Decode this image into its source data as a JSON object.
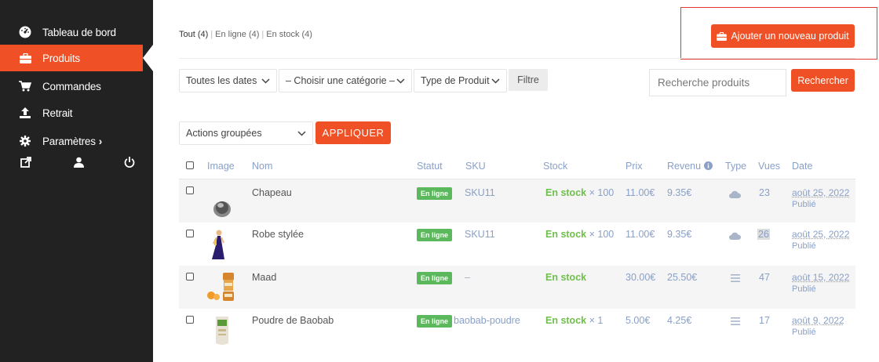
{
  "sidebar": {
    "items": [
      {
        "label": "Tableau de bord",
        "icon": "dashboard-icon"
      },
      {
        "label": "Produits",
        "icon": "briefcase-icon"
      },
      {
        "label": "Commandes",
        "icon": "cart-icon"
      },
      {
        "label": "Retrait",
        "icon": "upload-icon"
      },
      {
        "label": "Paramètres",
        "suffix": "›",
        "icon": "gear-icon"
      }
    ],
    "tools": [
      "external-link-icon",
      "user-icon",
      "power-icon"
    ]
  },
  "filters": {
    "all": "Tout (4)",
    "online": "En ligne (4)",
    "instock": "En stock (4)"
  },
  "add_product": "Ajouter un nouveau produit",
  "toolbar": {
    "dates": "Toutes les dates",
    "category": "– Choisir une catégorie –",
    "type": "Type de Produit",
    "filter": "Filtre",
    "search_placeholder": "Recherche produits",
    "search_button": "Rechercher",
    "bulk": "Actions groupées",
    "apply": "APPLIQUER"
  },
  "table": {
    "headers": [
      "Image",
      "Nom",
      "Statut",
      "SKU",
      "Stock",
      "Prix",
      "Revenu",
      "Type",
      "Vues",
      "Date"
    ],
    "rows": [
      {
        "name": "Chapeau",
        "status": "En ligne",
        "sku": "SKU11",
        "stock": "En stock",
        "qty": "× 100",
        "price": "11.00€",
        "revenue": "9.35€",
        "type": "cloud-icon",
        "views": "23",
        "date": "août 25, 2022",
        "published": "Publié"
      },
      {
        "name": "Robe stylée",
        "status": "En ligne",
        "sku": "SKU11",
        "stock": "En stock",
        "qty": "× 100",
        "price": "11.00€",
        "revenue": "9.35€",
        "type": "cloud-icon",
        "views": "26",
        "date": "août 25, 2022",
        "published": "Publié"
      },
      {
        "name": "Maad",
        "status": "En ligne",
        "sku": "–",
        "stock": "En stock",
        "qty": "",
        "price": "30.00€",
        "revenue": "25.50€",
        "type": "menu-icon",
        "views": "47",
        "date": "août 15, 2022",
        "published": "Publié"
      },
      {
        "name": "Poudre de Baobab",
        "status": "En ligne",
        "sku": "baobab-poudre",
        "stock": "En stock",
        "qty": "× 1",
        "price": "5.00€",
        "revenue": "4.25€",
        "type": "menu-icon",
        "views": "17",
        "date": "août 9, 2022",
        "published": "Publié"
      }
    ]
  },
  "colors": {
    "accent": "#f05025",
    "sidebar": "#222222",
    "badge": "#5cb85c",
    "stock": "#6fc04a",
    "muted": "#8aa0c8"
  }
}
